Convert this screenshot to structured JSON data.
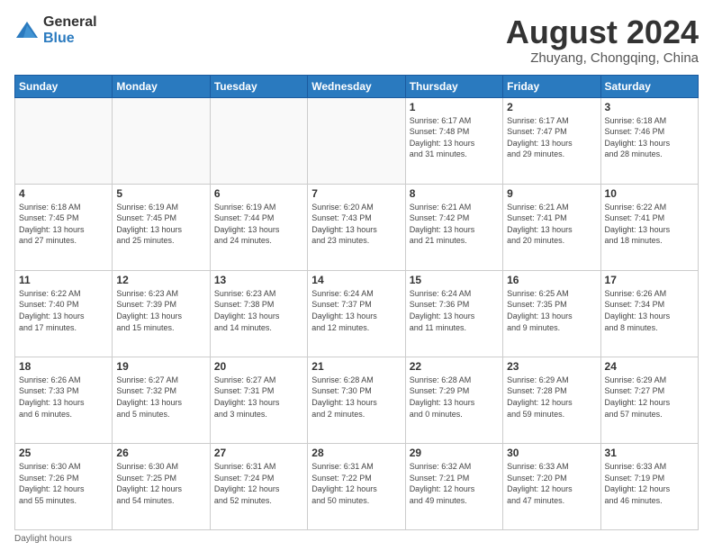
{
  "logo": {
    "general": "General",
    "blue": "Blue"
  },
  "title": "August 2024",
  "subtitle": "Zhuyang, Chongqing, China",
  "days_header": [
    "Sunday",
    "Monday",
    "Tuesday",
    "Wednesday",
    "Thursday",
    "Friday",
    "Saturday"
  ],
  "weeks": [
    [
      {
        "num": "",
        "info": ""
      },
      {
        "num": "",
        "info": ""
      },
      {
        "num": "",
        "info": ""
      },
      {
        "num": "",
        "info": ""
      },
      {
        "num": "1",
        "info": "Sunrise: 6:17 AM\nSunset: 7:48 PM\nDaylight: 13 hours\nand 31 minutes."
      },
      {
        "num": "2",
        "info": "Sunrise: 6:17 AM\nSunset: 7:47 PM\nDaylight: 13 hours\nand 29 minutes."
      },
      {
        "num": "3",
        "info": "Sunrise: 6:18 AM\nSunset: 7:46 PM\nDaylight: 13 hours\nand 28 minutes."
      }
    ],
    [
      {
        "num": "4",
        "info": "Sunrise: 6:18 AM\nSunset: 7:45 PM\nDaylight: 13 hours\nand 27 minutes."
      },
      {
        "num": "5",
        "info": "Sunrise: 6:19 AM\nSunset: 7:45 PM\nDaylight: 13 hours\nand 25 minutes."
      },
      {
        "num": "6",
        "info": "Sunrise: 6:19 AM\nSunset: 7:44 PM\nDaylight: 13 hours\nand 24 minutes."
      },
      {
        "num": "7",
        "info": "Sunrise: 6:20 AM\nSunset: 7:43 PM\nDaylight: 13 hours\nand 23 minutes."
      },
      {
        "num": "8",
        "info": "Sunrise: 6:21 AM\nSunset: 7:42 PM\nDaylight: 13 hours\nand 21 minutes."
      },
      {
        "num": "9",
        "info": "Sunrise: 6:21 AM\nSunset: 7:41 PM\nDaylight: 13 hours\nand 20 minutes."
      },
      {
        "num": "10",
        "info": "Sunrise: 6:22 AM\nSunset: 7:41 PM\nDaylight: 13 hours\nand 18 minutes."
      }
    ],
    [
      {
        "num": "11",
        "info": "Sunrise: 6:22 AM\nSunset: 7:40 PM\nDaylight: 13 hours\nand 17 minutes."
      },
      {
        "num": "12",
        "info": "Sunrise: 6:23 AM\nSunset: 7:39 PM\nDaylight: 13 hours\nand 15 minutes."
      },
      {
        "num": "13",
        "info": "Sunrise: 6:23 AM\nSunset: 7:38 PM\nDaylight: 13 hours\nand 14 minutes."
      },
      {
        "num": "14",
        "info": "Sunrise: 6:24 AM\nSunset: 7:37 PM\nDaylight: 13 hours\nand 12 minutes."
      },
      {
        "num": "15",
        "info": "Sunrise: 6:24 AM\nSunset: 7:36 PM\nDaylight: 13 hours\nand 11 minutes."
      },
      {
        "num": "16",
        "info": "Sunrise: 6:25 AM\nSunset: 7:35 PM\nDaylight: 13 hours\nand 9 minutes."
      },
      {
        "num": "17",
        "info": "Sunrise: 6:26 AM\nSunset: 7:34 PM\nDaylight: 13 hours\nand 8 minutes."
      }
    ],
    [
      {
        "num": "18",
        "info": "Sunrise: 6:26 AM\nSunset: 7:33 PM\nDaylight: 13 hours\nand 6 minutes."
      },
      {
        "num": "19",
        "info": "Sunrise: 6:27 AM\nSunset: 7:32 PM\nDaylight: 13 hours\nand 5 minutes."
      },
      {
        "num": "20",
        "info": "Sunrise: 6:27 AM\nSunset: 7:31 PM\nDaylight: 13 hours\nand 3 minutes."
      },
      {
        "num": "21",
        "info": "Sunrise: 6:28 AM\nSunset: 7:30 PM\nDaylight: 13 hours\nand 2 minutes."
      },
      {
        "num": "22",
        "info": "Sunrise: 6:28 AM\nSunset: 7:29 PM\nDaylight: 13 hours\nand 0 minutes."
      },
      {
        "num": "23",
        "info": "Sunrise: 6:29 AM\nSunset: 7:28 PM\nDaylight: 12 hours\nand 59 minutes."
      },
      {
        "num": "24",
        "info": "Sunrise: 6:29 AM\nSunset: 7:27 PM\nDaylight: 12 hours\nand 57 minutes."
      }
    ],
    [
      {
        "num": "25",
        "info": "Sunrise: 6:30 AM\nSunset: 7:26 PM\nDaylight: 12 hours\nand 55 minutes."
      },
      {
        "num": "26",
        "info": "Sunrise: 6:30 AM\nSunset: 7:25 PM\nDaylight: 12 hours\nand 54 minutes."
      },
      {
        "num": "27",
        "info": "Sunrise: 6:31 AM\nSunset: 7:24 PM\nDaylight: 12 hours\nand 52 minutes."
      },
      {
        "num": "28",
        "info": "Sunrise: 6:31 AM\nSunset: 7:22 PM\nDaylight: 12 hours\nand 50 minutes."
      },
      {
        "num": "29",
        "info": "Sunrise: 6:32 AM\nSunset: 7:21 PM\nDaylight: 12 hours\nand 49 minutes."
      },
      {
        "num": "30",
        "info": "Sunrise: 6:33 AM\nSunset: 7:20 PM\nDaylight: 12 hours\nand 47 minutes."
      },
      {
        "num": "31",
        "info": "Sunrise: 6:33 AM\nSunset: 7:19 PM\nDaylight: 12 hours\nand 46 minutes."
      }
    ]
  ],
  "footer": "Daylight hours"
}
